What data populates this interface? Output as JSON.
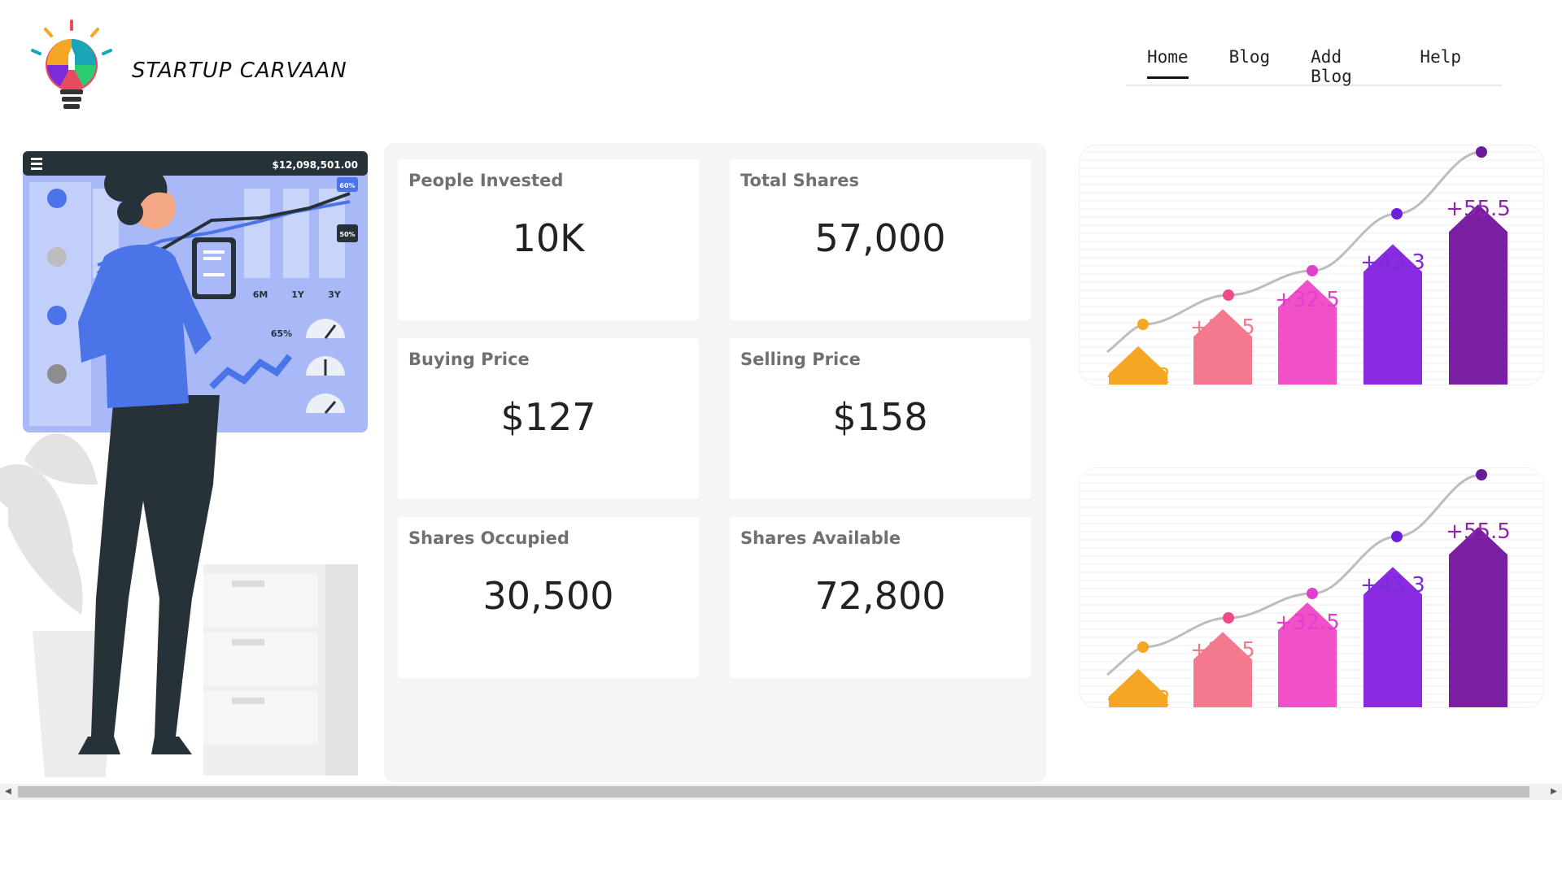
{
  "brand": {
    "name": "STARTUP CARVAAN"
  },
  "nav": {
    "items": [
      "Home",
      "Blog",
      "Add Blog",
      "Help"
    ],
    "active": "Home"
  },
  "illustration": {
    "screen_amount": "$12,098,501.00",
    "badge_top": "60%",
    "badge_mid": "50%",
    "range_labels": [
      "6M",
      "1Y",
      "3Y"
    ],
    "gauge_pct": "65%"
  },
  "stats": [
    {
      "label": "People Invested",
      "value": "10K"
    },
    {
      "label": "Total Shares",
      "value": "57,000"
    },
    {
      "label": "Buying Price",
      "value": "$127"
    },
    {
      "label": "Selling Price",
      "value": "$158"
    },
    {
      "label": "Shares Occupied",
      "value": "30,500"
    },
    {
      "label": "Shares Available",
      "value": "72,800"
    }
  ],
  "chart_data": [
    {
      "type": "bar",
      "categories": [
        "",
        "",
        "",
        "",
        ""
      ],
      "values": [
        12.2,
        23.5,
        32.5,
        43.3,
        55.5
      ],
      "data_labels": [
        "+12.2",
        "+23.5",
        "+32.5",
        "+43.3",
        "+55.5"
      ]
    },
    {
      "type": "bar",
      "categories": [
        "",
        "",
        "",
        "",
        ""
      ],
      "values": [
        12.2,
        23.5,
        32.5,
        43.3,
        55.5
      ],
      "data_labels": [
        "+12.2",
        "+23.5",
        "+32.5",
        "+43.3",
        "+55.5"
      ]
    }
  ],
  "colors": {
    "accent_purple": "#7b2bd8",
    "pink": "#f050c8",
    "salmon": "#f4788e",
    "orange": "#f5a623",
    "illustration_blue": "#4a74e8"
  }
}
